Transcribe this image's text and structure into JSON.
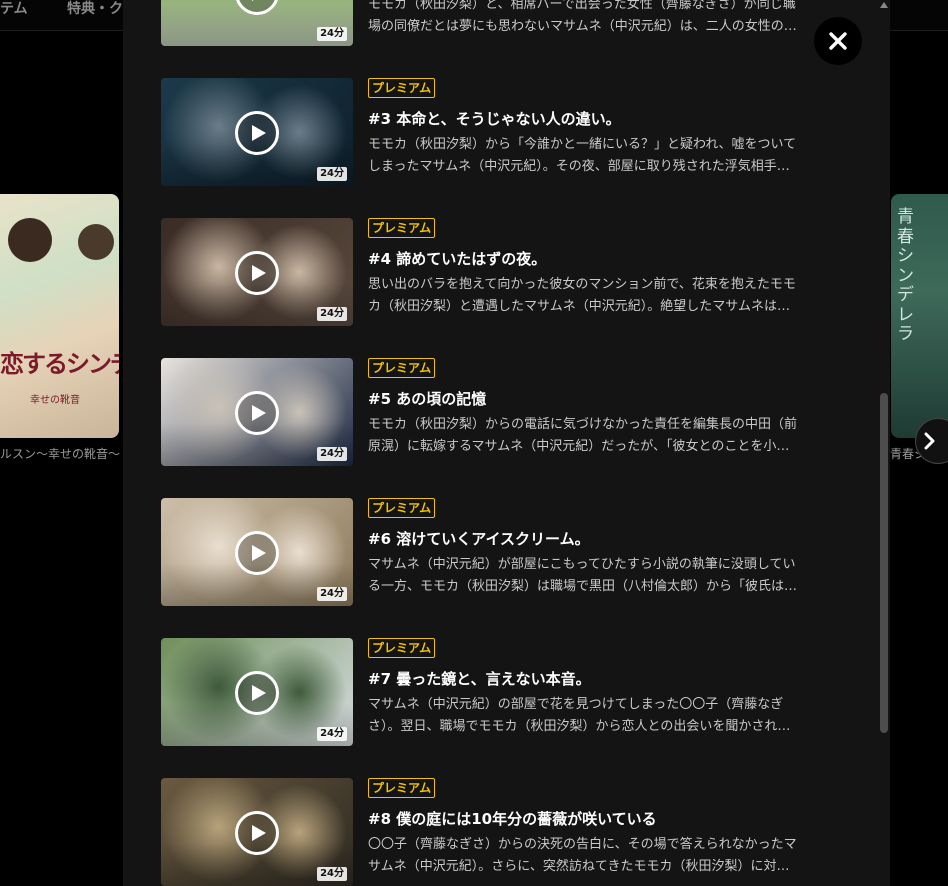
{
  "background": {
    "nav": [
      "テム",
      "特典・ク"
    ],
    "left_card": {
      "title_art": "恋するシンデレラ",
      "subtitle_art": "幸せの靴音",
      "caption": "ルスン〜幸せの靴音〜"
    },
    "right_card": {
      "title_art": "青春シンデレラ",
      "caption": "青春シ"
    }
  },
  "modal": {
    "top_episode": {
      "duration": "24分",
      "desc_lines": [
        "モモカ（秋田汐梨）と、相席ハーで出会った女性（齊藤なぎさ）が同じ職",
        "場の同僚だとは夢にも思わないマサムネ（中沢元紀）は、二人の女性の…"
      ]
    },
    "episodes": [
      {
        "badge": "プレミアム",
        "title": "#3 本命と、そうじゃない人の違い。",
        "duration": "24分",
        "desc_lines": [
          "モモカ（秋田汐梨）から「今誰かと一緒にいる？」と疑われ、嘘をついて",
          "しまったマサムネ（中沢元紀）。その夜、部屋に取り残された浮気相手…"
        ],
        "palette": [
          "#1b3a4a",
          "#0e1e2a",
          "#6a7c88"
        ]
      },
      {
        "badge": "プレミアム",
        "title": "#4 諦めていたはずの夜。",
        "duration": "24分",
        "desc_lines": [
          "思い出のバラを抱えて向かった彼女のマンション前で、花束を抱えたモモ",
          "カ（秋田汐梨）と遭遇したマサムネ（中沢元紀）。絶望したマサムネは…"
        ],
        "palette": [
          "#3a2c25",
          "#5a4a3f",
          "#c9b7a3"
        ]
      },
      {
        "badge": "プレミアム",
        "title": "#5 あの頃の記憶",
        "duration": "24分",
        "desc_lines": [
          "モモカ（秋田汐梨）からの電話に気づけなかった責任を編集長の中田（前",
          "原滉）に転嫁するマサムネ（中沢元紀）だったが、「彼女とのことを小…"
        ],
        "palette": [
          "#e8e4df",
          "#1e2a44",
          "#c9c2b8"
        ]
      },
      {
        "badge": "プレミアム",
        "title": "#6 溶けていくアイスクリーム。",
        "duration": "24分",
        "desc_lines": [
          "マサムネ（中沢元紀）が部屋にこもってひたすら小説の執筆に没頭してい",
          "る一方、モモカ（秋田汐梨）は職場で黒田（八村倫太郎）から「彼氏は…"
        ],
        "palette": [
          "#cdbfa8",
          "#8c7a5c",
          "#e9ded0"
        ]
      },
      {
        "badge": "プレミアム",
        "title": "#7 曇った鏡と、言えない本音。",
        "duration": "24分",
        "desc_lines": [
          "マサムネ（中沢元紀）の部屋で花を見つけてしまった〇〇子（齊藤なぎ",
          "さ）。翌日、職場でモモカ（秋田汐梨）から恋人との出会いを聞かされ…"
        ],
        "palette": [
          "#6f8f5a",
          "#d7dde0",
          "#3e5a3a"
        ]
      },
      {
        "badge": "プレミアム",
        "title": "#8 僕の庭には10年分の薔薇が咲いている",
        "duration": "24分",
        "desc_lines": [
          "〇〇子（齊藤なぎさ）からの決死の告白に、その場で答えられなかったマ",
          "サムネ（中沢元紀）。さらに、突然訪ねてきたモモカ（秋田汐梨）に対…"
        ],
        "palette": [
          "#6a5a40",
          "#2e2a22",
          "#b7a27a"
        ]
      }
    ]
  }
}
